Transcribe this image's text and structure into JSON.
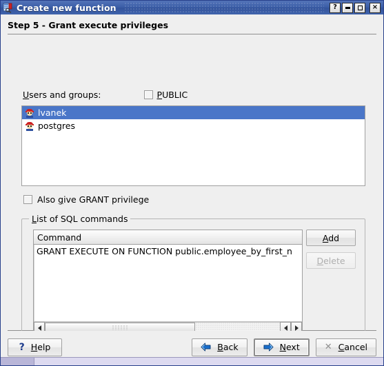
{
  "window": {
    "title": "Create new function",
    "icon": "function-wizard-icon",
    "buttons": {
      "help": "?",
      "minimize": "minimize-icon",
      "maximize": "maximize-icon",
      "close": "×"
    }
  },
  "header": {
    "step_title": "Step 5 - Grant execute privileges"
  },
  "form": {
    "users_label_pre": "U",
    "users_label_post": "sers and groups:",
    "public_label_pre": "P",
    "public_label_post": "UBLIC",
    "public_checked": false,
    "grant_label_pre": "Also ",
    "grant_label_key": "g",
    "grant_label_post": "ive GRANT privilege",
    "grant_checked": false
  },
  "user_list": {
    "items": [
      {
        "name": "lvanek",
        "icon": "user-icon",
        "selected": true
      },
      {
        "name": "postgres",
        "icon": "user-icon",
        "selected": false
      }
    ]
  },
  "sql_group": {
    "legend_pre": "L",
    "legend_post": "ist of SQL commands",
    "column_header": "Command",
    "rows": [
      "GRANT EXECUTE ON FUNCTION public.employee_by_first_n"
    ],
    "add_button": {
      "pre": "A",
      "post": "dd",
      "enabled": true
    },
    "delete_button": {
      "pre": "D",
      "post": "elete",
      "enabled": false
    },
    "scrollbar": {
      "left_arrow": "scroll-left-icon",
      "right_arrow": "scroll-right-icon"
    }
  },
  "footer": {
    "help": {
      "pre": "H",
      "post": "elp",
      "icon": "question-mark-icon"
    },
    "back": {
      "pre": "B",
      "post": "ack",
      "icon": "arrow-left-icon"
    },
    "next": {
      "pre": "N",
      "post": "ext",
      "icon": "arrow-right-icon",
      "default": true
    },
    "cancel": {
      "pre": "C",
      "post": "ancel",
      "icon": "cross-icon"
    }
  },
  "colors": {
    "titlebar": "#3c5fa8",
    "selection": "#4a76c8",
    "dialog_bg": "#efefef",
    "statusbar": "#cfcce6",
    "accent_arrow": "#1b6fcc"
  }
}
